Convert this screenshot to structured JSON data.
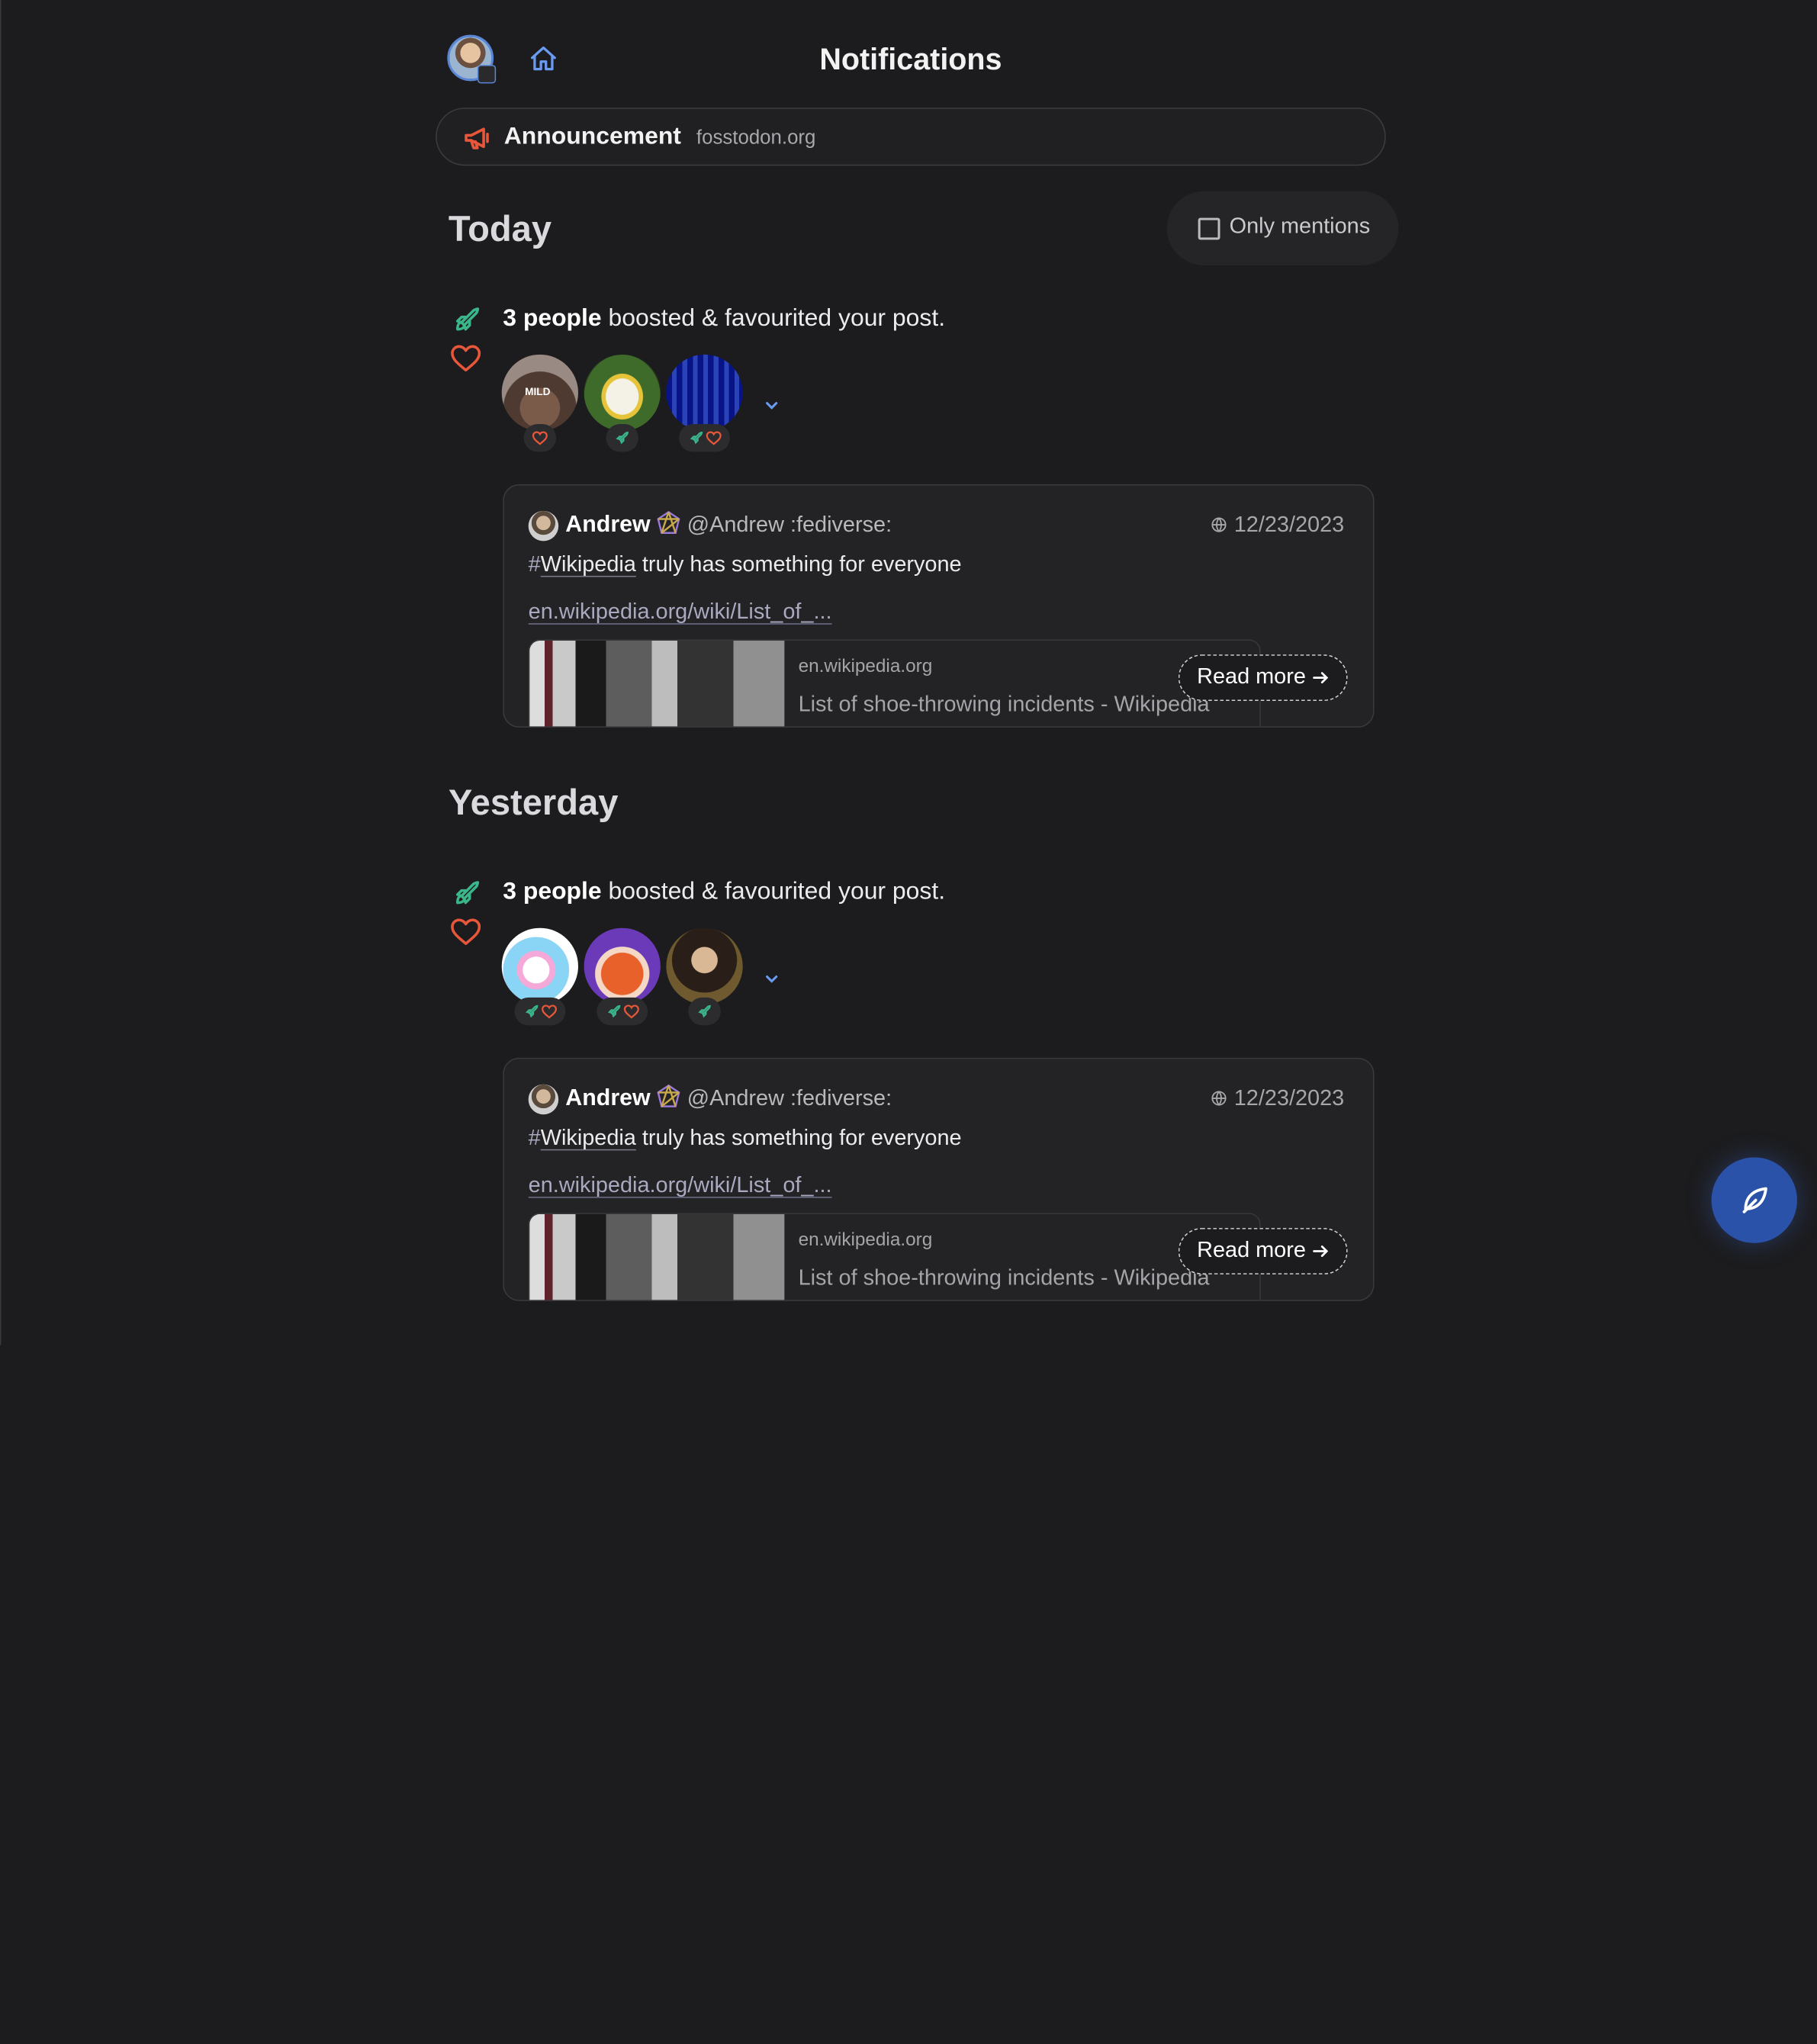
{
  "header": {
    "title": "Notifications",
    "home_icon": "home-icon",
    "accent": "#6b9bf0"
  },
  "announcement": {
    "label": "Announcement",
    "domain": "fosstodon.org",
    "icon": "megaphone-icon",
    "color": "#e8573a"
  },
  "filter": {
    "label": "Only mentions",
    "checked": false
  },
  "colors": {
    "boost": "#3bb58a",
    "favourite": "#e8573a"
  },
  "groups": [
    {
      "title": "Today",
      "notification": {
        "count_text": "3 people",
        "action_text": " boosted & favourited your post.",
        "avatars": [
          {
            "label": "MILD",
            "badges": [
              "favourite"
            ]
          },
          {
            "label": "",
            "badges": [
              "boost"
            ]
          },
          {
            "label": "",
            "badges": [
              "boost",
              "favourite"
            ]
          }
        ],
        "post": {
          "author": "Andrew",
          "handle": "@Andrew :fediverse:",
          "date": "12/23/2023",
          "hash": "#",
          "hashtag": "Wikipedia",
          "text": " truly has something for everyone",
          "link": "en.wikipedia.org/wiki/List_of_...",
          "card_site": "en.wikipedia.org",
          "card_title": "List of shoe-throwing incidents - Wikipedia",
          "read_more": "Read more"
        }
      }
    },
    {
      "title": "Yesterday",
      "notification": {
        "count_text": "3 people",
        "action_text": " boosted & favourited your post.",
        "avatars": [
          {
            "label": "",
            "badges": [
              "boost",
              "favourite"
            ]
          },
          {
            "label": "",
            "badges": [
              "boost",
              "favourite"
            ]
          },
          {
            "label": "",
            "badges": [
              "boost"
            ]
          }
        ],
        "post": {
          "author": "Andrew",
          "handle": "@Andrew :fediverse:",
          "date": "12/23/2023",
          "hash": "#",
          "hashtag": "Wikipedia",
          "text": " truly has something for everyone",
          "link": "en.wikipedia.org/wiki/List_of_...",
          "card_site": "en.wikipedia.org",
          "card_title": "List of shoe-throwing incidents - Wikipedia",
          "read_more": "Read more"
        }
      }
    }
  ],
  "compose": {
    "icon": "feather-icon"
  }
}
